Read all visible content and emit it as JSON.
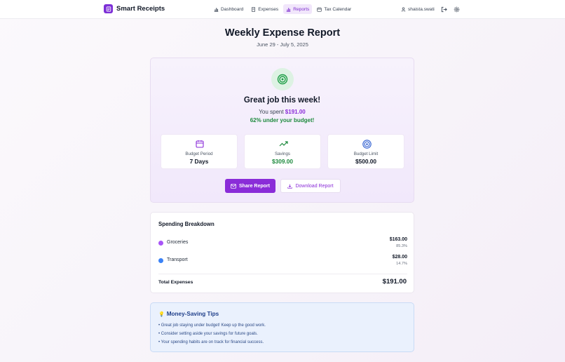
{
  "nav": {
    "brand": "Smart Receipts",
    "links": [
      {
        "label": "Dashboard",
        "icon": "bar-chart-icon",
        "active": false
      },
      {
        "label": "Expenses",
        "icon": "receipt-icon",
        "active": false
      },
      {
        "label": "Reports",
        "icon": "bar-chart-icon",
        "active": true
      },
      {
        "label": "Tax Calendar",
        "icon": "calendar-icon",
        "active": false
      }
    ],
    "username": "shaista.swati"
  },
  "report": {
    "title": "Weekly Expense Report",
    "date_range": "June 29 - July 5, 2025"
  },
  "summary": {
    "headline": "Great job this week!",
    "spent_prefix": "You spent",
    "spent_amount": "$191.00",
    "under_budget": "62% under your budget!",
    "stats": [
      {
        "label": "Budget Period",
        "value": "7 Days",
        "icon": "calendar-icon",
        "icon_color": "#8a2cd8"
      },
      {
        "label": "Savings",
        "value": "$309.00",
        "icon": "trending-up-icon",
        "icon_color": "#1e8a3e"
      },
      {
        "label": "Budget Limit",
        "value": "$500.00",
        "icon": "target-icon",
        "icon_color": "#2f5fd1"
      }
    ],
    "share_label": "Share Report",
    "download_label": "Download Report"
  },
  "breakdown": {
    "title": "Spending Breakdown",
    "items": [
      {
        "name": "Groceries",
        "amount": "$163.00",
        "percent": "85.3%",
        "color": "#a855f7"
      },
      {
        "name": "Transport",
        "amount": "$28.00",
        "percent": "14.7%",
        "color": "#3b82f6"
      }
    ],
    "total_label": "Total Expenses",
    "total_value": "$191.00"
  },
  "tips": {
    "title": "Money-Saving Tips",
    "items": [
      "• Great job staying under budget! Keep up the good work.",
      "• Consider setting aside your savings for future goals.",
      "• Your spending habits are on track for financial success."
    ]
  }
}
